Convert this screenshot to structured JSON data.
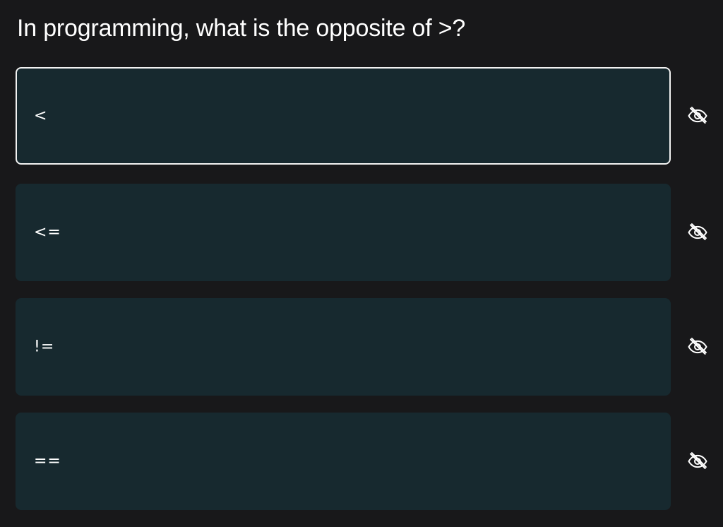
{
  "question": "In programming, what is the opposite of >?",
  "options": [
    {
      "label": "<",
      "selected": true
    },
    {
      "label": "<=",
      "selected": false
    },
    {
      "label": "!=",
      "selected": false
    },
    {
      "label": "==",
      "selected": false
    }
  ],
  "icons": {
    "hide_option": "eye-off-icon"
  },
  "colors": {
    "background": "#18181a",
    "card": "#17292f",
    "selected_border": "#f2f2f2",
    "text": "#ffffff"
  }
}
